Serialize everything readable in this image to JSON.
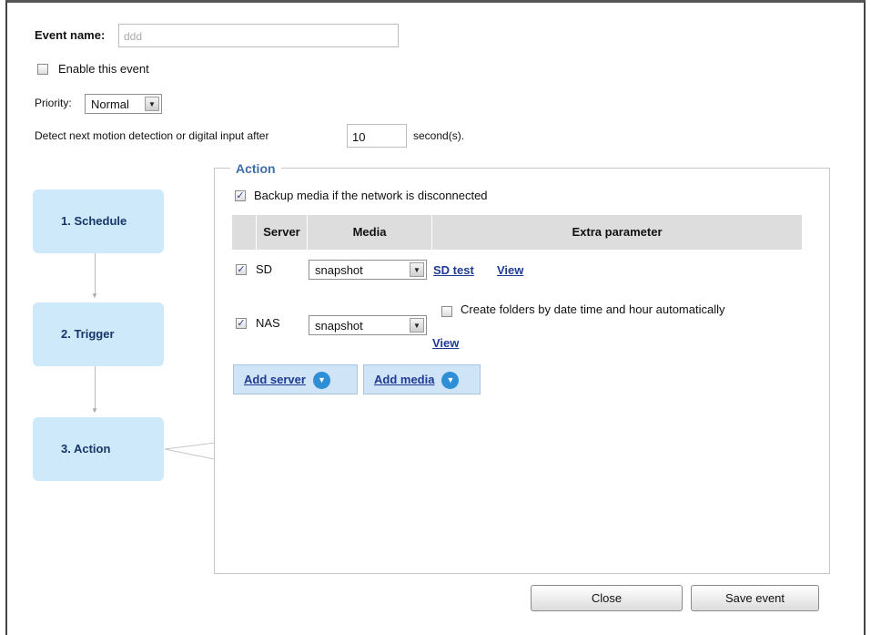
{
  "form": {
    "event_name_label": "Event name:",
    "event_name_value": "ddd",
    "enable_label": "Enable this event",
    "enable_checked": false,
    "priority_label": "Priority:",
    "priority_value": "Normal",
    "detect_label": "Detect next motion detection or digital input after",
    "detect_value": "10",
    "detect_unit": "second(s)."
  },
  "steps": [
    {
      "label": "1.  Schedule"
    },
    {
      "label": "2.  Trigger"
    },
    {
      "label": "3.  Action"
    }
  ],
  "action": {
    "legend": "Action",
    "backup_label": "Backup media if the network is disconnected",
    "backup_checked": true,
    "columns": [
      "Server",
      "Media",
      "Extra parameter"
    ],
    "rows": [
      {
        "server": "SD",
        "checked": true,
        "media": "snapshot",
        "links": [
          "SD test",
          "View"
        ]
      },
      {
        "server": "NAS",
        "checked": true,
        "media": "snapshot",
        "option_label": "Create folders by date time and hour automatically",
        "option_checked": false,
        "link": "View"
      }
    ],
    "add_server_label": "Add server",
    "add_media_label": "Add media"
  },
  "buttons": {
    "close_label": "Close",
    "save_label": "Save event"
  },
  "icons": {
    "dropdown": "chevron-down-icon",
    "add": "chevron-circle-down-icon",
    "flow_arrow": "arrow-down-icon"
  }
}
